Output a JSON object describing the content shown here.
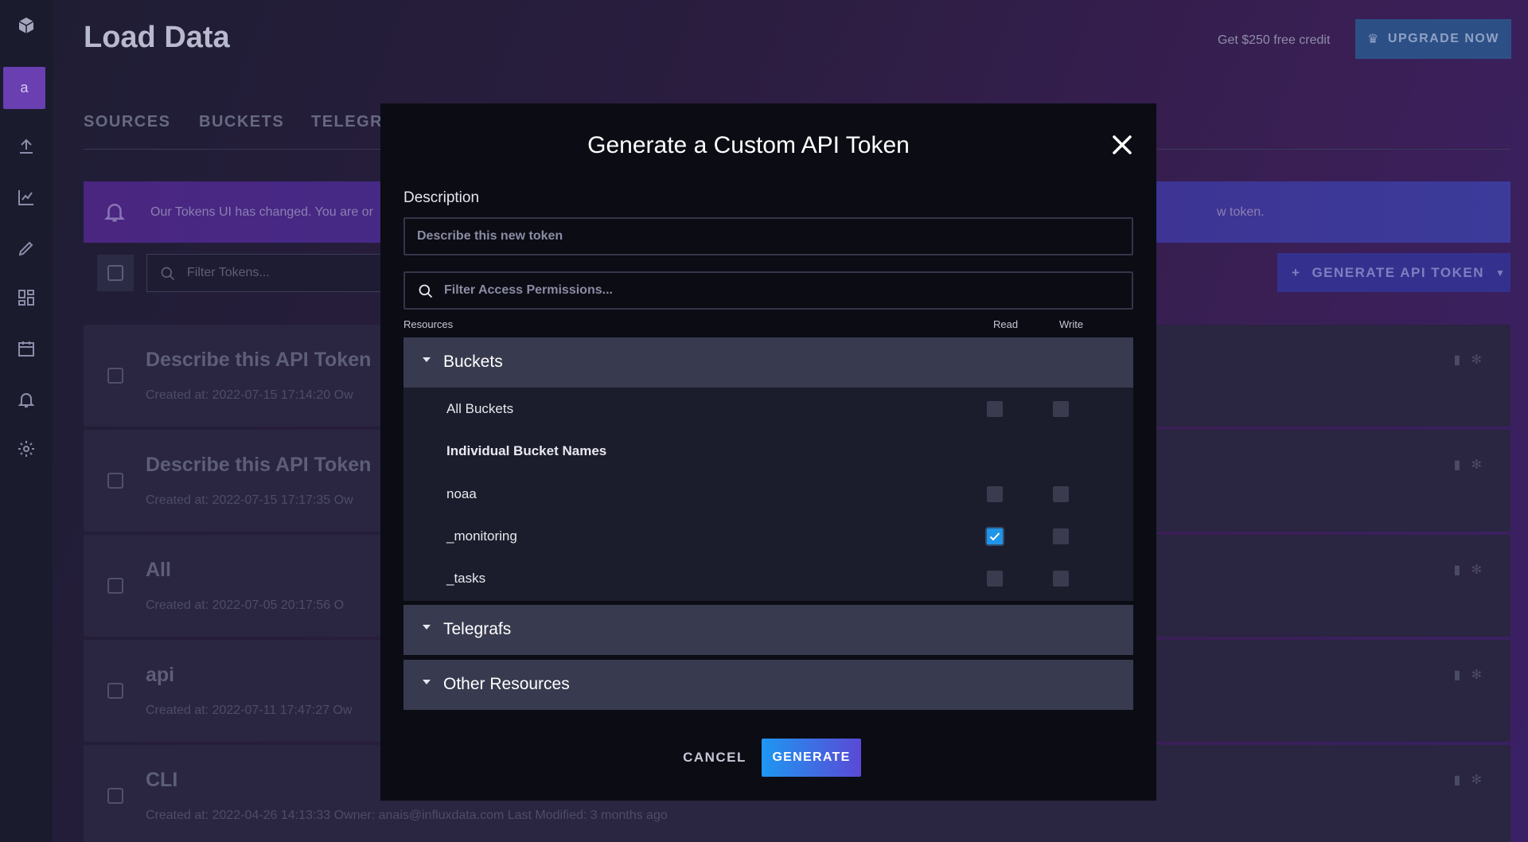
{
  "page": {
    "title": "Load Data",
    "credit_text": "Get $250 free credit",
    "upgrade_label": "UPGRADE NOW",
    "avatar_letter": "a"
  },
  "tabs": [
    "SOURCES",
    "BUCKETS",
    "TELEGR"
  ],
  "notice": {
    "text": "Our Tokens UI has changed. You are or",
    "tail": "w token."
  },
  "toolbar": {
    "filter_placeholder": "Filter Tokens...",
    "generate_label": "GENERATE API TOKEN"
  },
  "tokens": [
    {
      "name": "Describe this API Token",
      "meta": "Created at: 2022-07-15 17:14:20      Ow"
    },
    {
      "name": "Describe this API Token",
      "meta": "Created at: 2022-07-15 17:17:35      Ow"
    },
    {
      "name": "All",
      "meta": "Created at: 2022-07-05 20:17:56      O"
    },
    {
      "name": "api",
      "meta": "Created at: 2022-07-11 17:47:27      Ow"
    },
    {
      "name": "CLI",
      "meta": "Created at: 2022-04-26 14:13:33      Owner: anais@influxdata.com      Last Modified: 3 months ago"
    }
  ],
  "modal": {
    "title": "Generate a Custom API Token",
    "description_label": "Description",
    "description_placeholder": "Describe this new token",
    "filter_placeholder": "Filter Access Permissions...",
    "columns": {
      "resources": "Resources",
      "read": "Read",
      "write": "Write"
    },
    "sections": {
      "buckets": "Buckets",
      "telegrafs": "Telegrafs",
      "other": "Other Resources"
    },
    "bucket_rows": {
      "all": {
        "label": "All Buckets",
        "read": false,
        "write": false
      },
      "individual_header": "Individual Bucket Names",
      "items": [
        {
          "label": "noaa",
          "read": false,
          "write": false
        },
        {
          "label": "_monitoring",
          "read": true,
          "write": false
        },
        {
          "label": "_tasks",
          "read": false,
          "write": false
        }
      ]
    },
    "cancel_label": "CANCEL",
    "generate_label": "GENERATE"
  },
  "colors": {
    "accent": "#1f95e8",
    "generate_gradient_end": "#5a49d6",
    "modal_bg": "#0b0c14"
  }
}
